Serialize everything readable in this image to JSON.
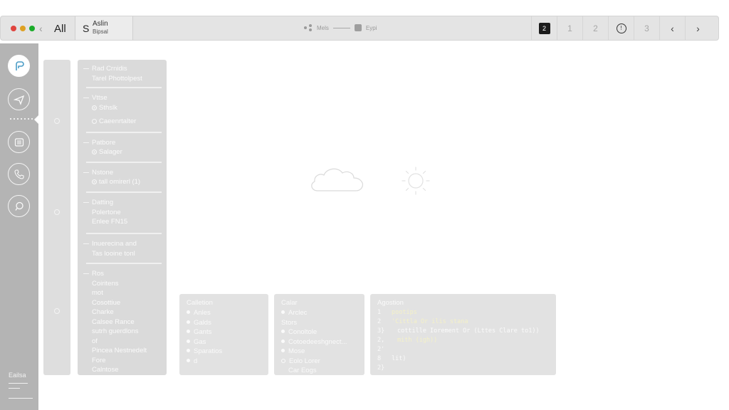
{
  "titlebar": {
    "traffic": [
      "#e0443e",
      "#dea123",
      "#1aab29"
    ],
    "back": "‹",
    "all_label": "All",
    "tab_letter": "S",
    "tab_title": "Aslin",
    "tab_sub": "Bipsal",
    "center_left": "Mels",
    "center_right": "Eypi",
    "controls": [
      "2",
      "1",
      "2",
      "",
      "3",
      "‹",
      "›"
    ]
  },
  "rail": {
    "footer": "Eailsa"
  },
  "list": {
    "items": [
      "Rad Crnidis\nTarel Phottolpest",
      "Vttse",
      "Sthslk",
      "Caeenrtalter",
      "Patbore",
      "Salager",
      "Nstone",
      "tall omirerl (1)",
      "Datting\nPolertone\nEnlee FN15",
      "Inuerecina and\nTas looine tonl",
      "Ros\nCoiritens\nmot\nCosottiue\nCharke\nCalsee Rance\nsutrh guerdlons\nof\nPincea Nestnedelt\nFore\nCalntose"
    ]
  },
  "cards": {
    "collection": {
      "title": "Calletion",
      "items": [
        "Anles",
        "Galds",
        "Gants",
        "Gas",
        "Sparatios",
        "d"
      ]
    },
    "calar": {
      "title": "Calar",
      "items": [
        "Arclec",
        "Stors",
        "Conoltole",
        "Cotoedeeshgnect...",
        "Mose",
        "Eolo Lorer",
        "Car Eogs"
      ]
    },
    "agostion": {
      "title": "Agostion",
      "lines": [
        {
          "n": "1",
          "t": "pootips"
        },
        {
          "n": "2",
          "t": "'Cittla Or ilis stana"
        },
        {
          "n": "3}",
          "t": "cottille Iorement Or (Lttes Clare to1))"
        },
        {
          "n": "2,",
          "t": "mith  (igh))"
        },
        {
          "n": "2'",
          "t": ""
        },
        {
          "n": "8",
          "t": "lit)"
        },
        {
          "n": "2}",
          "t": ""
        }
      ]
    }
  }
}
